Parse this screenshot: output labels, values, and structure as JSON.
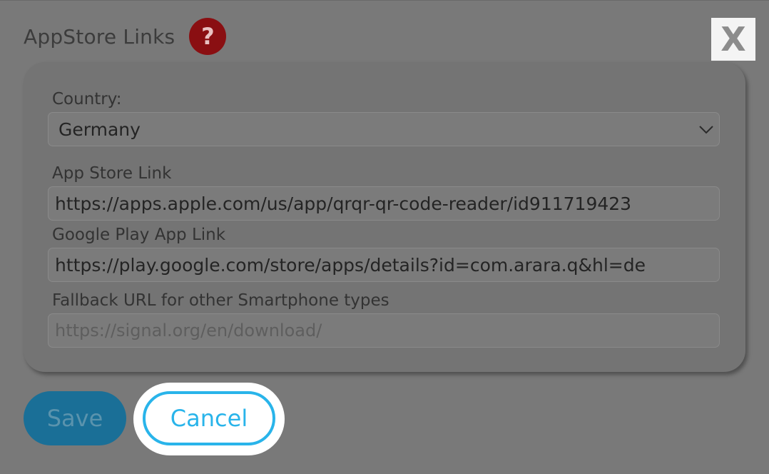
{
  "dialog": {
    "title": "AppStore Links",
    "help_icon_glyph": "?",
    "close_glyph": "X"
  },
  "form": {
    "country_label": "Country:",
    "country_value": "Germany",
    "app_store_label": "App Store Link",
    "app_store_value": "https://apps.apple.com/us/app/qrqr-qr-code-reader/id911719423",
    "google_play_label": "Google Play App Link",
    "google_play_value": "https://play.google.com/store/apps/details?id=com.arara.q&hl=de",
    "fallback_label": "Fallback URL for other Smartphone types",
    "fallback_placeholder": "https://signal.org/en/download/"
  },
  "actions": {
    "save_label": "Save",
    "cancel_label": "Cancel"
  },
  "colors": {
    "help_icon": "#8a0f12",
    "save_button": "#1a6f97",
    "cancel_accent": "#29b4ea"
  }
}
